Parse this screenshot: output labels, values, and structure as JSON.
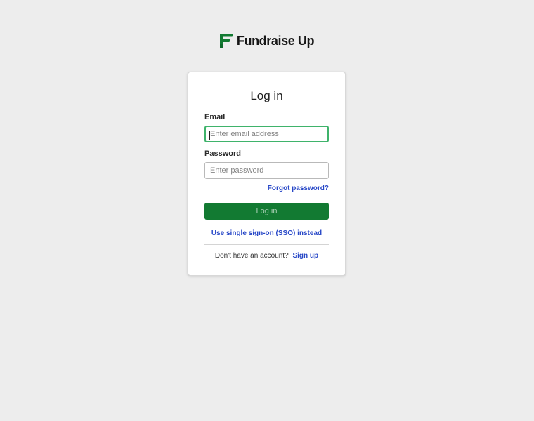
{
  "brand": {
    "name": "Fundraise Up",
    "accent_color": "#127a32",
    "logo_icon": "fundraise-up-f-mark"
  },
  "login": {
    "title": "Log in",
    "email_label": "Email",
    "email_placeholder": "Enter email address",
    "email_value": "",
    "password_label": "Password",
    "password_placeholder": "Enter password",
    "password_value": "",
    "forgot_password": "Forgot password?",
    "submit_label": "Log in",
    "sso_link": "Use single sign-on (SSO) instead",
    "no_account_text": "Don't have an account?",
    "signup_link": "Sign up"
  },
  "colors": {
    "background": "#ededed",
    "focus_border": "#3fb36b",
    "link": "#2747c7"
  }
}
